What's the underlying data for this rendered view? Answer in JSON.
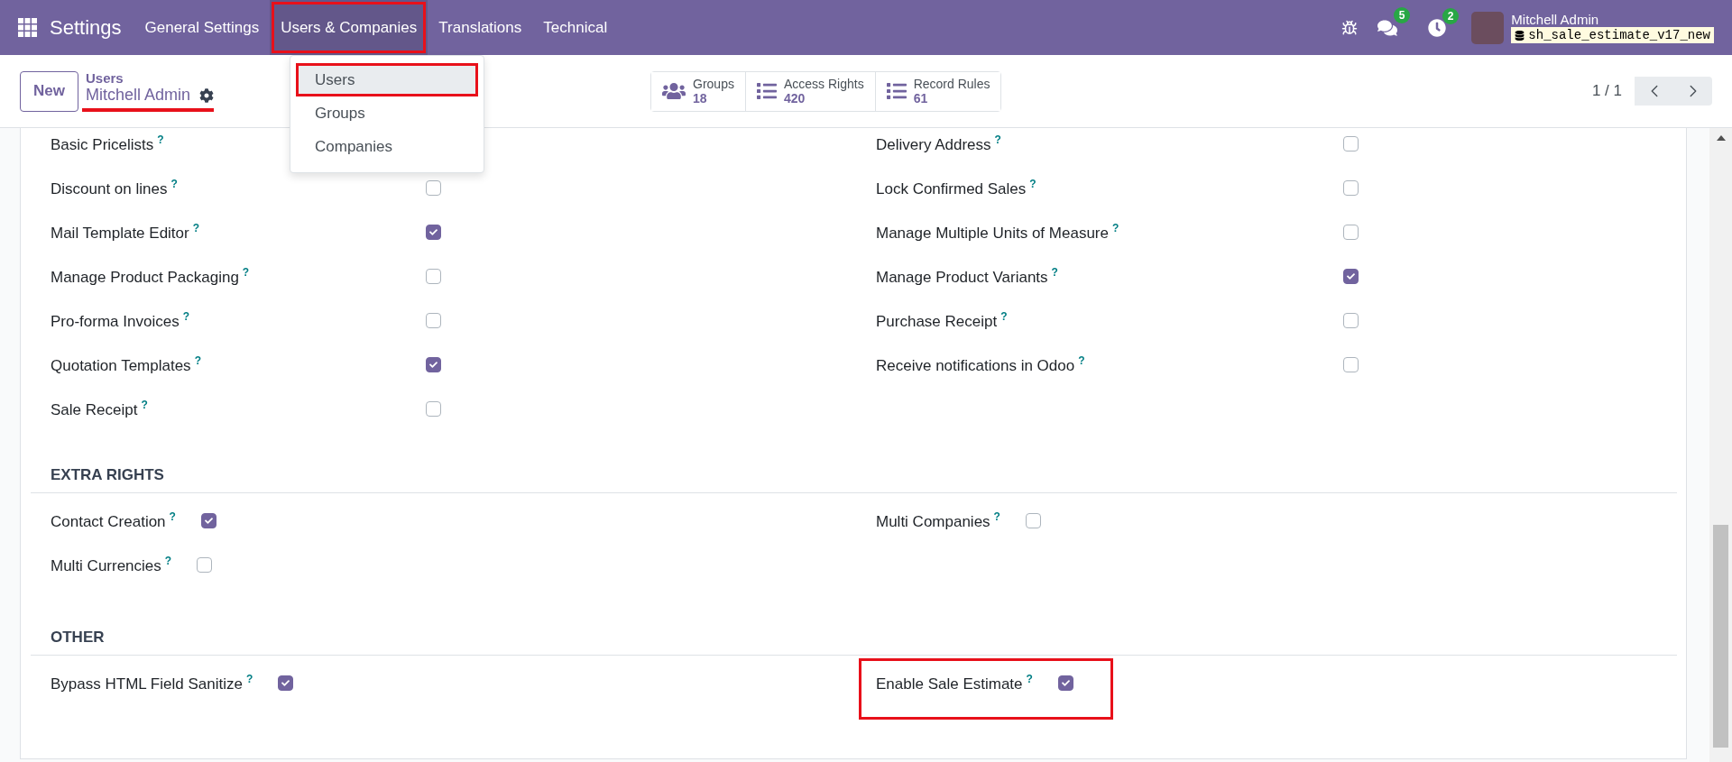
{
  "navbar": {
    "app": "Settings",
    "menus": [
      {
        "label": "General Settings",
        "selected": false,
        "highlighted": false
      },
      {
        "label": "Users & Companies",
        "selected": true,
        "highlighted": true
      },
      {
        "label": "Translations",
        "selected": false,
        "highlighted": false
      },
      {
        "label": "Technical",
        "selected": false,
        "highlighted": false
      }
    ],
    "messages_count": "5",
    "activities_count": "2",
    "user": "Mitchell Admin",
    "database": "sh_sale_estimate_v17_new"
  },
  "dropdown": {
    "items": [
      {
        "label": "Users",
        "selected": true,
        "highlighted": true
      },
      {
        "label": "Groups",
        "selected": false,
        "highlighted": false
      },
      {
        "label": "Companies",
        "selected": false,
        "highlighted": false
      }
    ]
  },
  "control_panel": {
    "new_button": "New",
    "breadcrumb": "Users",
    "record": "Mitchell Admin",
    "record_underlined": true,
    "stat_buttons": [
      {
        "kind": "users",
        "label": "Groups",
        "value": "18"
      },
      {
        "kind": "list",
        "label": "Access Rights",
        "value": "420"
      },
      {
        "kind": "list",
        "label": "Record Rules",
        "value": "61"
      }
    ],
    "pager": "1 / 1"
  },
  "sections": [
    {
      "left": [
        {
          "label": "Basic Pricelists",
          "help": "?"
        },
        {
          "label": "Discount on lines",
          "help": "?",
          "checked": false
        },
        {
          "label": "Mail Template Editor",
          "help": "?",
          "checked": true
        },
        {
          "label": "Manage Product Packaging",
          "help": "?",
          "checked": false
        },
        {
          "label": "Pro-forma Invoices",
          "help": "?",
          "checked": false
        },
        {
          "label": "Quotation Templates",
          "help": "?",
          "checked": true
        },
        {
          "label": "Sale Receipt",
          "help": "?",
          "checked": false
        }
      ],
      "right": [
        {
          "label": "Delivery Address",
          "help": "?",
          "checked": false
        },
        {
          "label": "Lock Confirmed Sales",
          "help": "?",
          "checked": false
        },
        {
          "label": "Manage Multiple Units of Measure",
          "help": "?",
          "checked": false
        },
        {
          "label": "Manage Product Variants",
          "help": "?",
          "checked": true
        },
        {
          "label": "Purchase Receipt",
          "help": "?",
          "checked": false
        },
        {
          "label": "Receive notifications in Odoo",
          "help": "?",
          "checked": false
        }
      ]
    },
    {
      "title": "EXTRA RIGHTS",
      "left": [
        {
          "label": "Contact Creation",
          "help": "?",
          "checked": true
        },
        {
          "label": "Multi Currencies",
          "help": "?",
          "checked": false
        }
      ],
      "right": [
        {
          "label": "Multi Companies",
          "help": "?",
          "checked": false
        }
      ]
    },
    {
      "title": "OTHER",
      "left": [
        {
          "label": "Bypass HTML Field Sanitize",
          "help": "?",
          "checked": true
        }
      ],
      "right": [
        {
          "label": "Enable Sale Estimate",
          "help": "?",
          "checked": true,
          "highlighted": true
        }
      ]
    }
  ]
}
